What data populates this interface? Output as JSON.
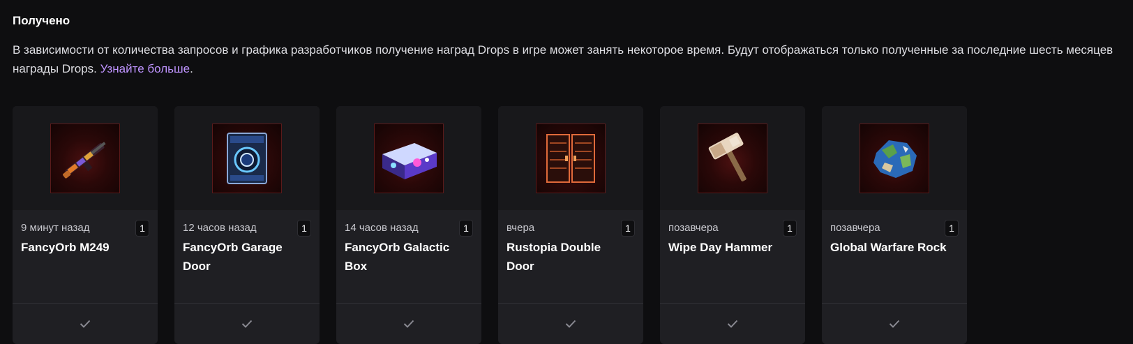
{
  "section": {
    "heading": "Получено",
    "description": "В зависимости от количества запросов и графика разработчиков получение наград Drops в игре может занять некоторое время. Будут отображаться только полученные за последние шесть месяцев награды Drops.",
    "learn_more": "Узнайте больше",
    "period": "."
  },
  "accent_color": "#bf94ff",
  "cards": [
    {
      "time": "9 минут назад",
      "count": "1",
      "name": "FancyOrb M249",
      "icon": "rifle-icon"
    },
    {
      "time": "12 часов назад",
      "count": "1",
      "name": "FancyOrb Garage Door",
      "icon": "garage-door-icon"
    },
    {
      "time": "14 часов назад",
      "count": "1",
      "name": "FancyOrb Galactic Box",
      "icon": "galactic-box-icon"
    },
    {
      "time": "вчера",
      "count": "1",
      "name": "Rustopia Double Door",
      "icon": "double-door-icon"
    },
    {
      "time": "позавчера",
      "count": "1",
      "name": "Wipe Day Hammer",
      "icon": "hammer-icon"
    },
    {
      "time": "позавчера",
      "count": "1",
      "name": "Global Warfare Rock",
      "icon": "rock-icon"
    }
  ],
  "claimed_icon": "checkmark-icon"
}
